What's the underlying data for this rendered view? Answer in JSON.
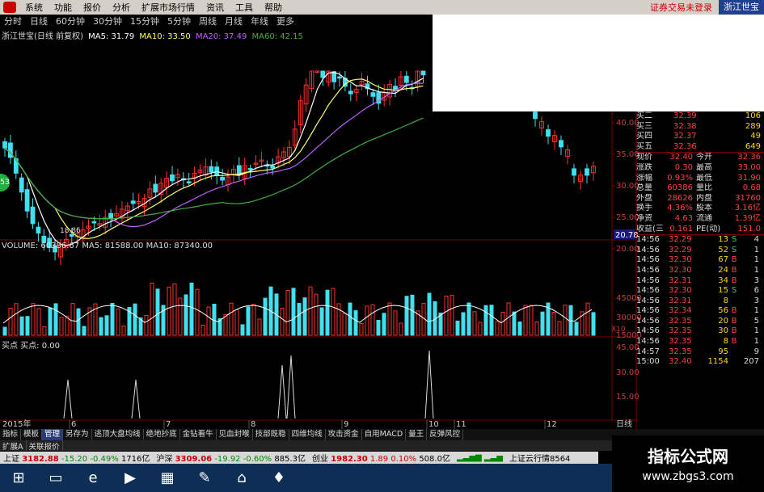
{
  "menubar": {
    "items": [
      "系统",
      "功能",
      "报价",
      "分析",
      "扩展市场行情",
      "资讯",
      "工具",
      "帮助"
    ],
    "login": "证券交易未登录",
    "stock_name": "浙江世宝"
  },
  "tabs": [
    "分时",
    "日线",
    "60分钟",
    "30分钟",
    "15分钟",
    "5分钟",
    "周线",
    "月线",
    "年线",
    "更多"
  ],
  "legend": {
    "title": "浙江世宝(日线 前复权)",
    "ma5": "MA5: 31.79",
    "ma10": "MA10: 33.50",
    "ma20": "MA20: 37.49",
    "ma60": "MA60: 42.15"
  },
  "colors": {
    "ma5": "#ffffff",
    "ma10": "#ffff66",
    "ma20": "#c060ff",
    "ma60": "#40b040",
    "up": "#ff3030",
    "down": "#40e0f0"
  },
  "price_axis": [
    "40.00",
    "35.00",
    "30.00",
    "25.00",
    "20.00"
  ],
  "price_box": "20.78",
  "low_label": "18.86",
  "volume": {
    "label": "VOLUME: 60386.67 MA5: 81588.00 MA10: 87340.00",
    "axis": [
      "45000",
      "30000",
      "15000"
    ],
    "unit": "X10"
  },
  "bsp": {
    "label": "买点 买点: 0.00",
    "axis": [
      "45.00",
      "30.00",
      "15.00"
    ]
  },
  "dates": {
    "year": "2015年",
    "months": [
      "6",
      "7",
      "8",
      "9",
      "10",
      "11",
      "12"
    ],
    "right": "日线"
  },
  "side_chip": "53",
  "quotes": [
    {
      "l": "买二",
      "p": "32.39",
      "v": "106"
    },
    {
      "l": "买三",
      "p": "32.38",
      "v": "289"
    },
    {
      "l": "买四",
      "p": "32.37",
      "v": "49"
    },
    {
      "l": "买五",
      "p": "32.36",
      "v": "649"
    }
  ],
  "stats": [
    {
      "l1": "现价",
      "v1": "32.40",
      "l2": "今开",
      "v2": "32.36"
    },
    {
      "l1": "涨跌",
      "v1": "0.30",
      "l2": "最高",
      "v2": "33.00"
    },
    {
      "l1": "涨幅",
      "v1": "0.93%",
      "l2": "最低",
      "v2": "31.90"
    },
    {
      "l1": "总量",
      "v1": "60386",
      "l2": "量比",
      "v2": "0.68"
    },
    {
      "l1": "外盘",
      "v1": "28626",
      "l2": "内盘",
      "v2": "31760"
    },
    {
      "l1": "换手",
      "v1": "4.36%",
      "l2": "股本",
      "v2": "3.16亿"
    },
    {
      "l1": "净资",
      "v1": "4.63",
      "l2": "流通",
      "v2": "1.39亿"
    },
    {
      "l1": "收益(三)",
      "v1": "0.161",
      "l2": "PE(动)",
      "v2": "151.0"
    }
  ],
  "ticks": [
    {
      "t": "14:56",
      "p": "32.29",
      "v": "13",
      "f": "S",
      "n": "4"
    },
    {
      "t": "14:56",
      "p": "32.29",
      "v": "52",
      "f": "S",
      "n": "1"
    },
    {
      "t": "14:56",
      "p": "32.30",
      "v": "67",
      "f": "B",
      "n": "1"
    },
    {
      "t": "14:56",
      "p": "32.30",
      "v": "24",
      "f": "B",
      "n": "1"
    },
    {
      "t": "14:56",
      "p": "32.31",
      "v": "34",
      "f": "B",
      "n": "3"
    },
    {
      "t": "14:56",
      "p": "32.30",
      "v": "15",
      "f": "S",
      "n": "6"
    },
    {
      "t": "14:56",
      "p": "32.31",
      "v": "8",
      "f": "",
      "n": "3"
    },
    {
      "t": "14:56",
      "p": "32.34",
      "v": "56",
      "f": "B",
      "n": "1"
    },
    {
      "t": "14:56",
      "p": "32.35",
      "v": "20",
      "f": "B",
      "n": "5"
    },
    {
      "t": "14:56",
      "p": "32.35",
      "v": "30",
      "f": "B",
      "n": "1"
    },
    {
      "t": "14:56",
      "p": "32.35",
      "v": "8",
      "f": "B",
      "n": "1"
    },
    {
      "t": "14:57",
      "p": "32.35",
      "v": "95",
      "f": "",
      "n": "9"
    },
    {
      "t": "15:00",
      "p": "32.40",
      "v": "1154",
      "f": "",
      "n": "207"
    }
  ],
  "bottom_tabs": [
    "指标",
    "模板",
    "管理",
    "另存为",
    "逃顶大盘均线",
    "绝地抄底",
    "金钻看牛",
    "见血封喉",
    "技部既稳",
    "四维均线",
    "攻击资金",
    "自用MACD",
    "量王",
    "反弹风控"
  ],
  "bottom_tabs2": [
    "扩展A",
    "关联报价"
  ],
  "status": [
    {
      "name": "上证",
      "val": "3182.88",
      "chg": "-15.20",
      "pct": "-0.49%",
      "amt": "1716亿"
    },
    {
      "name": "沪深",
      "val": "3309.06",
      "chg": "-19.92",
      "pct": "-0.60%",
      "amt": "885.3亿"
    },
    {
      "name": "创业",
      "val": "1982.30",
      "chg": "1.89",
      "pct": "0.10%",
      "amt": "508.0亿"
    }
  ],
  "status_tail": "上证云行情8564",
  "watermark": {
    "line1": "指标公式网",
    "line2": "www.zbgs3.com"
  }
}
